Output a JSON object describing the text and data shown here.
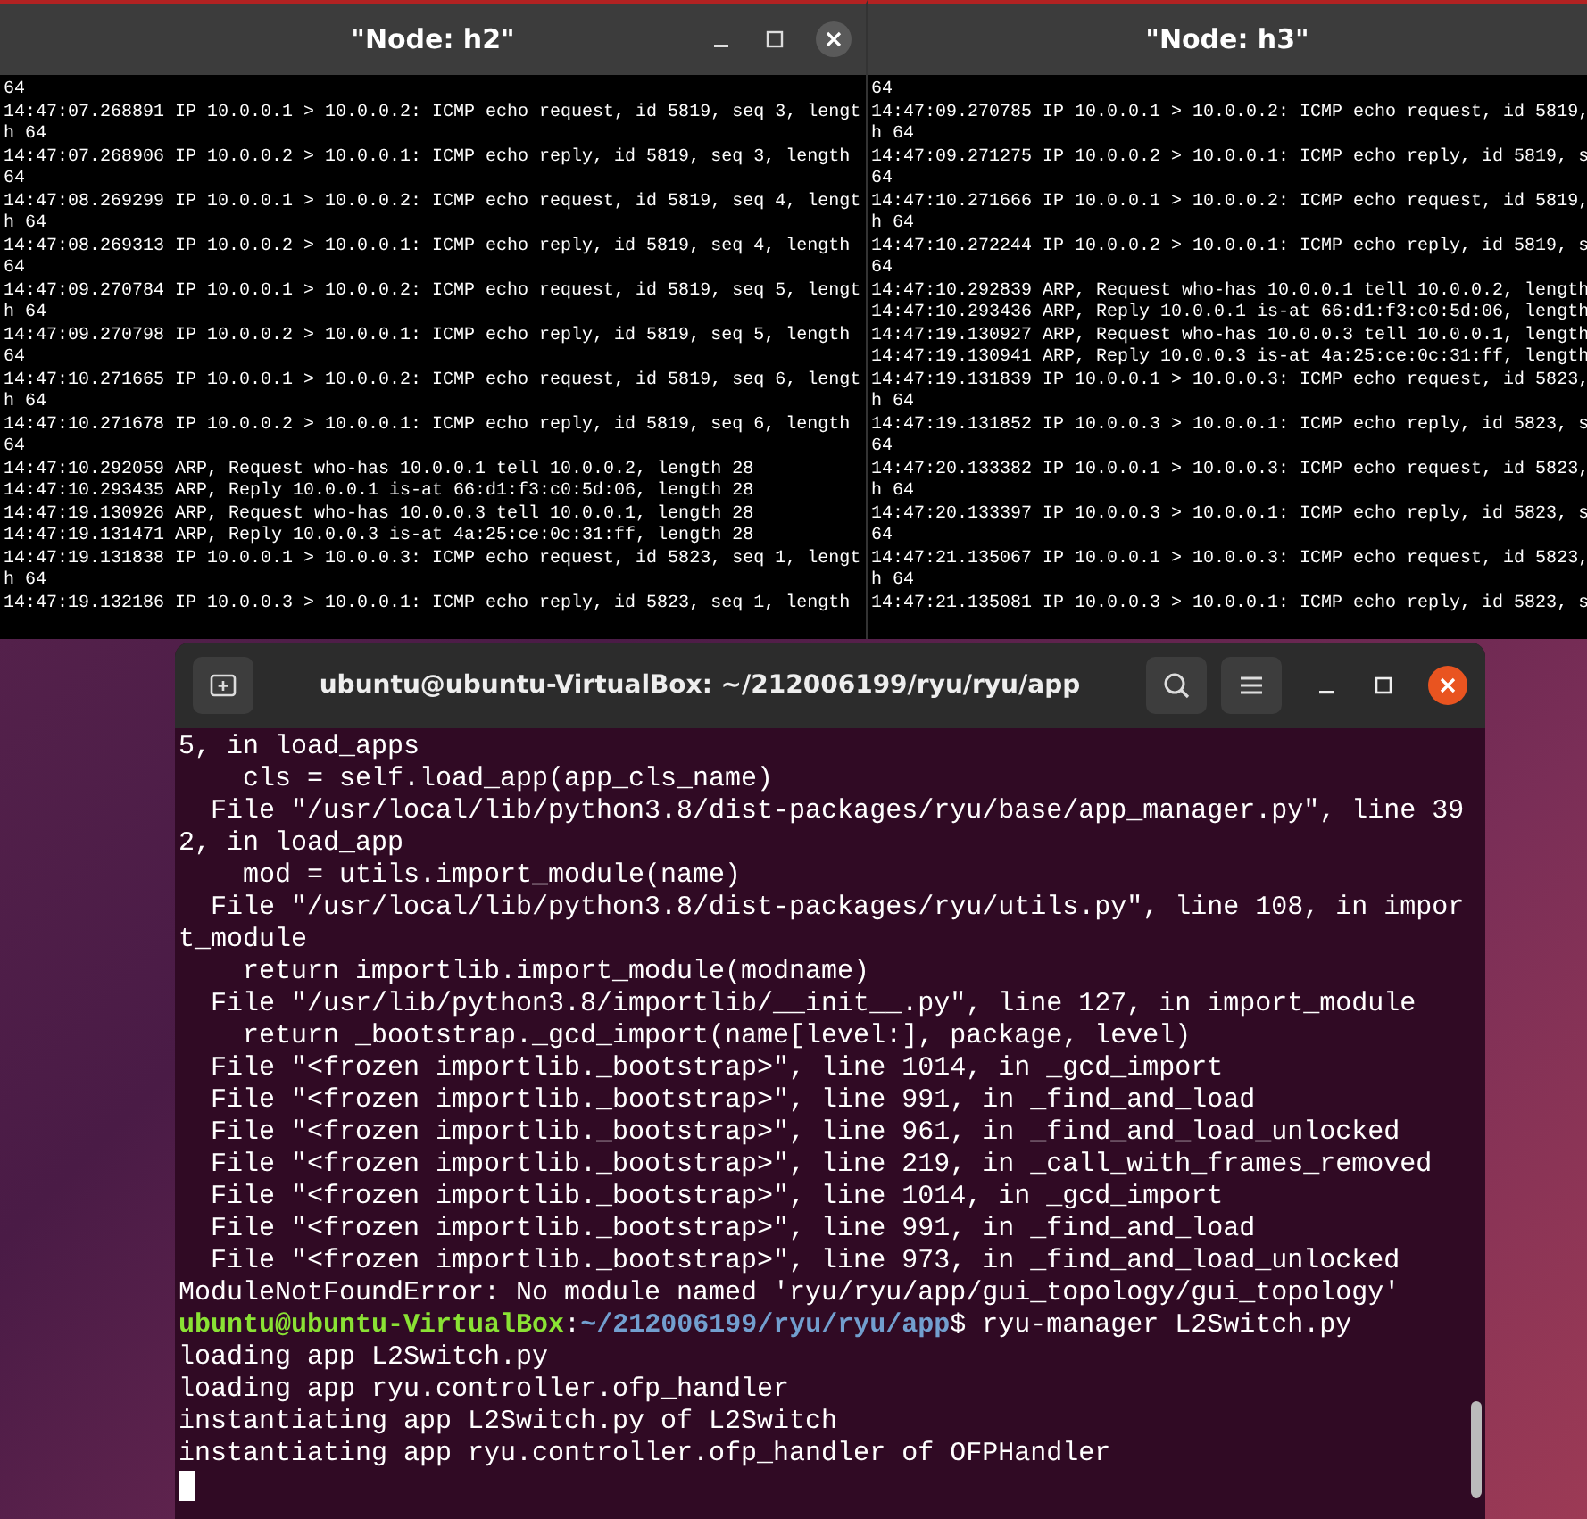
{
  "xterm_windows": [
    {
      "title": "\"Node: h2\"",
      "controls": true,
      "lines": [
        "64",
        "14:47:07.268891 IP 10.0.0.1 > 10.0.0.2: ICMP echo request, id 5819, seq 3, lengt",
        "h 64",
        "14:47:07.268906 IP 10.0.0.2 > 10.0.0.1: ICMP echo reply, id 5819, seq 3, length",
        "64",
        "14:47:08.269299 IP 10.0.0.1 > 10.0.0.2: ICMP echo request, id 5819, seq 4, lengt",
        "h 64",
        "14:47:08.269313 IP 10.0.0.2 > 10.0.0.1: ICMP echo reply, id 5819, seq 4, length",
        "64",
        "14:47:09.270784 IP 10.0.0.1 > 10.0.0.2: ICMP echo request, id 5819, seq 5, lengt",
        "h 64",
        "14:47:09.270798 IP 10.0.0.2 > 10.0.0.1: ICMP echo reply, id 5819, seq 5, length",
        "64",
        "14:47:10.271665 IP 10.0.0.1 > 10.0.0.2: ICMP echo request, id 5819, seq 6, lengt",
        "h 64",
        "14:47:10.271678 IP 10.0.0.2 > 10.0.0.1: ICMP echo reply, id 5819, seq 6, length",
        "64",
        "14:47:10.292059 ARP, Request who-has 10.0.0.1 tell 10.0.0.2, length 28",
        "14:47:10.293435 ARP, Reply 10.0.0.1 is-at 66:d1:f3:c0:5d:06, length 28",
        "14:47:19.130926 ARP, Request who-has 10.0.0.3 tell 10.0.0.1, length 28",
        "14:47:19.131471 ARP, Reply 10.0.0.3 is-at 4a:25:ce:0c:31:ff, length 28",
        "14:47:19.131838 IP 10.0.0.1 > 10.0.0.3: ICMP echo request, id 5823, seq 1, lengt",
        "h 64",
        "14:47:19.132186 IP 10.0.0.3 > 10.0.0.1: ICMP echo reply, id 5823, seq 1, length"
      ]
    },
    {
      "title": "\"Node: h3\"",
      "controls": false,
      "lines": [
        "64",
        "14:47:09.270785 IP 10.0.0.1 > 10.0.0.2: ICMP echo request, id 5819,",
        "h 64",
        "14:47:09.271275 IP 10.0.0.2 > 10.0.0.1: ICMP echo reply, id 5819, s",
        "64",
        "14:47:10.271666 IP 10.0.0.1 > 10.0.0.2: ICMP echo request, id 5819,",
        "h 64",
        "14:47:10.272244 IP 10.0.0.2 > 10.0.0.1: ICMP echo reply, id 5819, s",
        "64",
        "14:47:10.292839 ARP, Request who-has 10.0.0.1 tell 10.0.0.2, length",
        "14:47:10.293436 ARP, Reply 10.0.0.1 is-at 66:d1:f3:c0:5d:06, length",
        "14:47:19.130927 ARP, Request who-has 10.0.0.3 tell 10.0.0.1, length",
        "14:47:19.130941 ARP, Reply 10.0.0.3 is-at 4a:25:ce:0c:31:ff, length",
        "14:47:19.131839 IP 10.0.0.1 > 10.0.0.3: ICMP echo request, id 5823,",
        "h 64",
        "14:47:19.131852 IP 10.0.0.3 > 10.0.0.1: ICMP echo reply, id 5823, s",
        "64",
        "14:47:20.133382 IP 10.0.0.1 > 10.0.0.3: ICMP echo request, id 5823,",
        "h 64",
        "14:47:20.133397 IP 10.0.0.3 > 10.0.0.1: ICMP echo reply, id 5823, s",
        "64",
        "14:47:21.135067 IP 10.0.0.1 > 10.0.0.3: ICMP echo request, id 5823,",
        "h 64",
        "14:47:21.135081 IP 10.0.0.3 > 10.0.0.1: ICMP echo reply, id 5823, s"
      ]
    }
  ],
  "terminal": {
    "title": "ubuntu@ubuntu-VirtualBox: ~/212006199/ryu/ryu/app",
    "lines": [
      {
        "kind": "text",
        "text": "5, in load_apps"
      },
      {
        "kind": "text",
        "text": "    cls = self.load_app(app_cls_name)"
      },
      {
        "kind": "text",
        "text": "  File \"/usr/local/lib/python3.8/dist-packages/ryu/base/app_manager.py\", line 39"
      },
      {
        "kind": "text",
        "text": "2, in load_app"
      },
      {
        "kind": "text",
        "text": "    mod = utils.import_module(name)"
      },
      {
        "kind": "text",
        "text": "  File \"/usr/local/lib/python3.8/dist-packages/ryu/utils.py\", line 108, in impor"
      },
      {
        "kind": "text",
        "text": "t_module"
      },
      {
        "kind": "text",
        "text": "    return importlib.import_module(modname)"
      },
      {
        "kind": "text",
        "text": "  File \"/usr/lib/python3.8/importlib/__init__.py\", line 127, in import_module"
      },
      {
        "kind": "text",
        "text": "    return _bootstrap._gcd_import(name[level:], package, level)"
      },
      {
        "kind": "text",
        "text": "  File \"<frozen importlib._bootstrap>\", line 1014, in _gcd_import"
      },
      {
        "kind": "text",
        "text": "  File \"<frozen importlib._bootstrap>\", line 991, in _find_and_load"
      },
      {
        "kind": "text",
        "text": "  File \"<frozen importlib._bootstrap>\", line 961, in _find_and_load_unlocked"
      },
      {
        "kind": "text",
        "text": "  File \"<frozen importlib._bootstrap>\", line 219, in _call_with_frames_removed"
      },
      {
        "kind": "text",
        "text": "  File \"<frozen importlib._bootstrap>\", line 1014, in _gcd_import"
      },
      {
        "kind": "text",
        "text": "  File \"<frozen importlib._bootstrap>\", line 991, in _find_and_load"
      },
      {
        "kind": "text",
        "text": "  File \"<frozen importlib._bootstrap>\", line 973, in _find_and_load_unlocked"
      },
      {
        "kind": "text",
        "text": "ModuleNotFoundError: No module named 'ryu/ryu/app/gui_topology/gui_topology'"
      },
      {
        "kind": "prompt",
        "user": "ubuntu@ubuntu-VirtualBox",
        "sep": ":",
        "path": "~/212006199/ryu/ryu/app",
        "command": "$ ryu-manager L2Switch.py"
      },
      {
        "kind": "text",
        "text": "loading app L2Switch.py"
      },
      {
        "kind": "text",
        "text": "loading app ryu.controller.ofp_handler"
      },
      {
        "kind": "text",
        "text": "instantiating app L2Switch.py of L2Switch"
      },
      {
        "kind": "text",
        "text": "instantiating app ryu.controller.ofp_handler of OFPHandler"
      },
      {
        "kind": "cursor"
      }
    ]
  }
}
